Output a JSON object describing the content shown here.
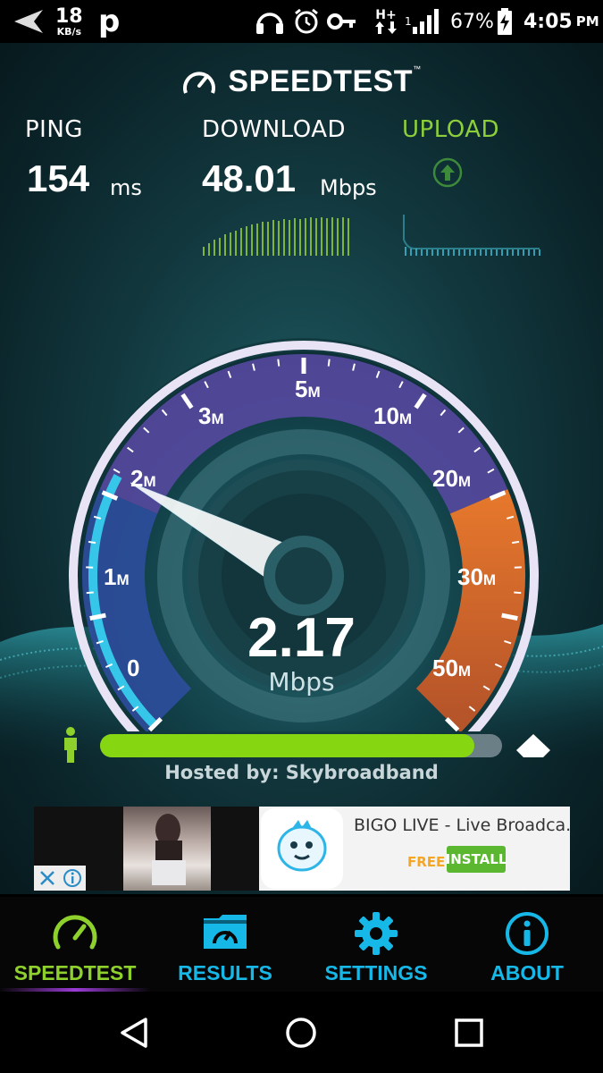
{
  "status_bar": {
    "net_speed": "18",
    "net_speed_unit": "KB/s",
    "notif_glyph": "p",
    "network_type": "H+",
    "sim_slot": "1",
    "battery_percent": "67%",
    "time": "4:05",
    "time_suffix": "PM",
    "icons": [
      "back-arrow-icon",
      "headphones-icon",
      "alarm-icon",
      "vpn-key-icon",
      "data-arrows-icon",
      "signal-icon",
      "battery-charging-icon"
    ]
  },
  "header": {
    "brand": "SPEEDTEST",
    "trademark": "™"
  },
  "metrics": {
    "ping": {
      "label": "PING",
      "value": "154",
      "unit": "ms"
    },
    "download": {
      "label": "DOWNLOAD",
      "value": "48.01",
      "unit": "Mbps"
    },
    "upload": {
      "label": "UPLOAD"
    }
  },
  "gauge": {
    "labels": [
      {
        "num": "0",
        "unit": ""
      },
      {
        "num": "1",
        "unit": "M"
      },
      {
        "num": "2",
        "unit": "M"
      },
      {
        "num": "3",
        "unit": "M"
      },
      {
        "num": "5",
        "unit": "M"
      },
      {
        "num": "10",
        "unit": "M"
      },
      {
        "num": "20",
        "unit": "M"
      },
      {
        "num": "30",
        "unit": "M"
      },
      {
        "num": "50",
        "unit": "M"
      }
    ],
    "current_speed": "2.17",
    "current_unit": "Mbps",
    "needle_value_mbps": 2.17
  },
  "progress": {
    "fraction": 0.93
  },
  "server": {
    "hosted_by": "Hosted by: Skybroadband"
  },
  "ad": {
    "title": "BIGO LIVE - Live Broadca...",
    "price": "FREE",
    "cta": "INSTALL"
  },
  "tabs": [
    {
      "label": "SPEEDTEST",
      "icon": "gauge-icon",
      "active": true
    },
    {
      "label": "RESULTS",
      "icon": "results-folder-icon",
      "active": false
    },
    {
      "label": "SETTINGS",
      "icon": "gear-icon",
      "active": false
    },
    {
      "label": "ABOUT",
      "icon": "info-icon",
      "active": false
    }
  ],
  "colors": {
    "accent_green": "#8fd12c",
    "accent_blue": "#16b8e8",
    "progress_green": "#86d712",
    "upload_green": "#8ccf3a"
  }
}
